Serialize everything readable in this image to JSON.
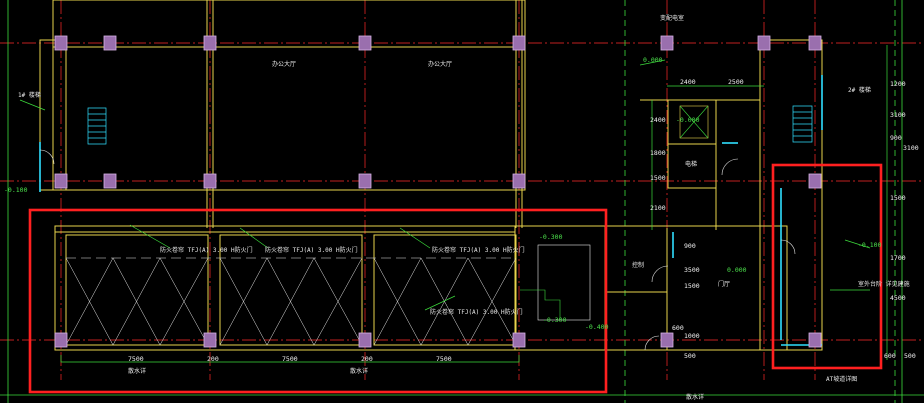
{
  "drawing": {
    "colors": {
      "background": "#000000",
      "wall": "#e8d44d",
      "axis": "#ff2a2a",
      "column": "#b98cc8",
      "highlight": "#ff2020",
      "green": "#3cdc3c",
      "cyan": "#2fe0ff",
      "white": "#e8e8e8"
    },
    "labels": {
      "elev_top": "0.000",
      "elev_stair": "-0.100",
      "elev_ramp": "-0.300",
      "elev_lobby": "0.000",
      "elev_right": "-0.100",
      "elev_small1": "-0.300",
      "elev_small2": "-0.000",
      "elev_small3": "-0.400",
      "room_hall_left": "办公大厅",
      "room_hall_right": "办公大厅",
      "room_lobby": "门厅",
      "room_shaft": "电梯",
      "room_ctrl": "控制",
      "room_top": "变配电室",
      "stair_left": "1# 楼梯",
      "stair_right": "2# 楼梯",
      "garage_1": "防火卷帘 TFJ(A) 3.00 H防火门",
      "garage_2": "防火卷帘 TFJ(A) 3.00 H防火门",
      "garage_3": "防火卷帘 TFJ(A) 3.00 H防火门",
      "garage_4": "防火卷帘 TFJ(A) 3.00 H防火门",
      "note_right": "室外台阶 详见建施",
      "note_bottom_left": "散水详",
      "note_bottom_mid": "散水详",
      "note_bottom_right": "AT坡道详图",
      "note_bottom_far": "散水详"
    },
    "dims": {
      "d7500a": "7500",
      "d7500b": "7500",
      "d7500c": "7500",
      "d200a": "200",
      "d200b": "200",
      "d2400": "2400",
      "d2500": "2500",
      "d2400v": "2400",
      "d1800": "1800",
      "d1500": "1500",
      "d2100": "2100",
      "d900": "900",
      "d3500": "3500",
      "d1500b": "1500",
      "d500": "500",
      "d1000": "1000",
      "d600": "600",
      "d1500c": "1500",
      "d1700": "1700",
      "d4500": "4500",
      "d3100": "3100",
      "d900b": "900",
      "d1200": "1200",
      "d600b": "600",
      "d500b": "500",
      "d3100b": "3100"
    }
  }
}
